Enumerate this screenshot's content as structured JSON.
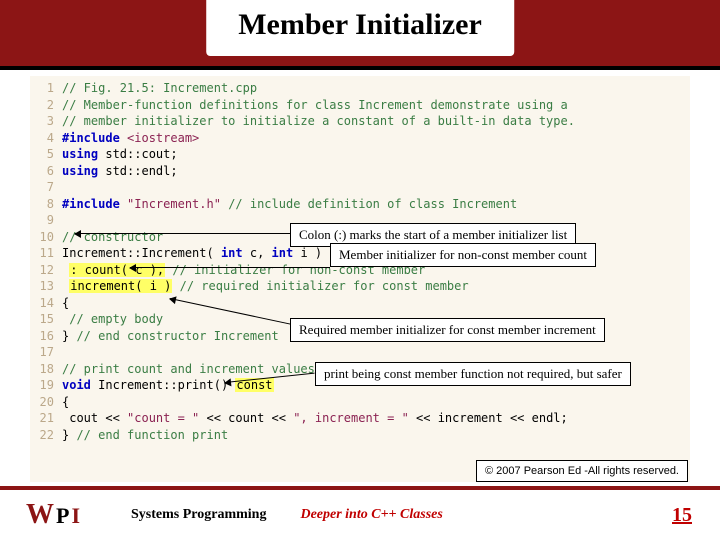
{
  "title": "Member Initializer",
  "code": {
    "l1": "// Fig. 21.5: Increment.cpp",
    "l2": "// Member-function definitions for class Increment demonstrate using a",
    "l3": "// member initializer to initialize a constant of a built-in data type.",
    "inc4": "#include",
    "io4": "<iostream>",
    "us5a": "using",
    "us5b": "std::cout;",
    "us6a": "using",
    "us6b": "std::endl;",
    "inc8": "#include",
    "str8": "\"Increment.h\"",
    "cmt8": "// include definition of class Increment",
    "cmt10": "// constructor",
    "l11a": "Increment::Increment( ",
    "kw11b": "int",
    "l11c": " c, ",
    "kw11d": "int",
    "l11e": " i )",
    "hl12a": ": count( c ),",
    "cmt12b": " // initializer for non-const member",
    "hl13a": "increment( i )",
    "cmt13b": " // required initializer for const member",
    "l14": "{",
    "cmt15": "// empty body",
    "l16a": "} ",
    "cmt16b": "// end constructor Increment",
    "cmt18": "// print count and increment values",
    "kw19a": "void",
    "l19b": " Increment::print() ",
    "hl19c": "const",
    "l20": "{",
    "l21a": "   cout << ",
    "s21b": "\"count = \"",
    "l21c": " << count << ",
    "s21d": "\", increment = \"",
    "l21e": " << increment << endl;",
    "l22a": "} ",
    "cmt22b": "// end function print"
  },
  "callouts": {
    "c1": "Colon (:) marks the start of a member initializer list",
    "c2": "Member initializer for non-const member count",
    "c3": "Required member initializer for const member increment",
    "c4": "print being  const member function not required, but safer"
  },
  "copyright": "© 2007 Pearson Ed -All rights reserved.",
  "footer": {
    "center": "Systems Programming",
    "right": "Deeper into C++ Classes",
    "page": "15"
  }
}
